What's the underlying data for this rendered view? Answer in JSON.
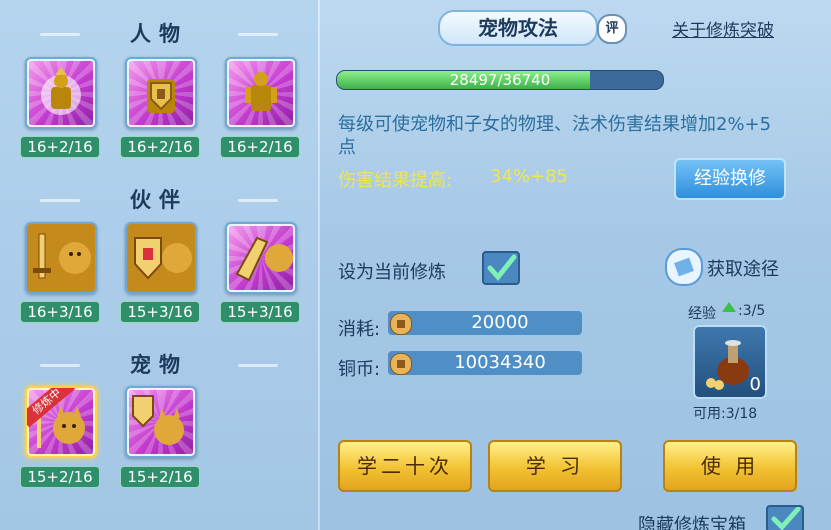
{
  "left": {
    "sections": [
      {
        "title": "人物",
        "slots": [
          {
            "level": "16+2/16",
            "icon": "glowing-figure-icon"
          },
          {
            "level": "16+2/16",
            "icon": "shield-armor-icon"
          },
          {
            "level": "16+2/16",
            "icon": "armor-figure-icon"
          }
        ]
      },
      {
        "title": "伙伴",
        "slots": [
          {
            "level": "16+3/16",
            "icon": "sword-lion-icon"
          },
          {
            "level": "15+3/16",
            "icon": "shield-lion-icon"
          },
          {
            "level": "15+3/16",
            "icon": "gauntlet-lion-icon"
          }
        ]
      },
      {
        "title": "宠物",
        "slots": [
          {
            "level": "15+2/16",
            "icon": "cat-sword-icon",
            "badge": "修炼中"
          },
          {
            "level": "15+2/16",
            "icon": "cat-shield-icon"
          }
        ]
      }
    ]
  },
  "header": {
    "tab_title": "宠物攻法",
    "rating_label": "评",
    "link": "关于修炼突破"
  },
  "progress": {
    "text": "28497/36740",
    "current": 28497,
    "max": 36740
  },
  "description": "每级可使宠物和子女的物理、法术伤害结果增加2%+5点",
  "damage": {
    "label": "伤害结果提高:",
    "value": "34%+85"
  },
  "buttons": {
    "exchange": "经验换修",
    "learn20": "学二十次",
    "learn": "学 习",
    "use": "使 用"
  },
  "set_current": {
    "label": "设为当前修炼",
    "checked": true
  },
  "obtain": "获取途径",
  "cost": {
    "label": "消耗:",
    "value": "20000"
  },
  "copper": {
    "label": "铜币:",
    "value": "10034340"
  },
  "item": {
    "exp_label": "经验",
    "exp_value": ":3/5",
    "count": "0",
    "available": "可用:3/18"
  },
  "hide_box": {
    "label": "隐藏修炼宝箱",
    "checked": true
  },
  "colors": {
    "accent_gold": "#f0e64c",
    "level_green": "#2f8f6a"
  }
}
